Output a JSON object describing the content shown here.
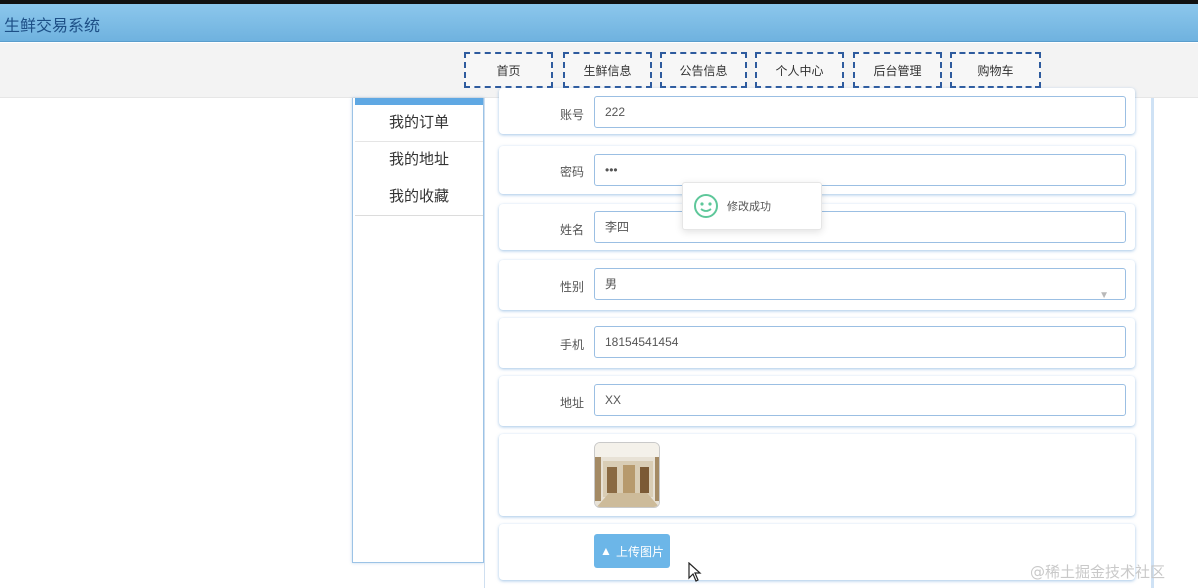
{
  "app": {
    "title": "生鲜交易系统"
  },
  "nav": {
    "items": [
      {
        "label": "首页"
      },
      {
        "label": "生鲜信息"
      },
      {
        "label": "公告信息"
      },
      {
        "label": "个人中心"
      },
      {
        "label": "后台管理"
      },
      {
        "label": "购物车"
      }
    ]
  },
  "sidebar": {
    "items": [
      {
        "label": "我的订单"
      },
      {
        "label": "我的地址"
      },
      {
        "label": "我的收藏"
      }
    ]
  },
  "form": {
    "account": {
      "label": "账号",
      "value": "222"
    },
    "password": {
      "label": "密码",
      "value": "•••"
    },
    "name": {
      "label": "姓名",
      "value": "李四"
    },
    "gender": {
      "label": "性别",
      "value": "男"
    },
    "phone": {
      "label": "手机",
      "value": "18154541454"
    },
    "address": {
      "label": "地址",
      "value": "XX"
    },
    "upload_label": "上传图片"
  },
  "toast": {
    "message": "修改成功"
  },
  "colors": {
    "accent": "#5fa8e3",
    "titlebar": "#7ab9e3",
    "success": "#5ec79a",
    "nav_border": "#2e5b9e"
  },
  "watermark": "@稀土掘金技术社区"
}
